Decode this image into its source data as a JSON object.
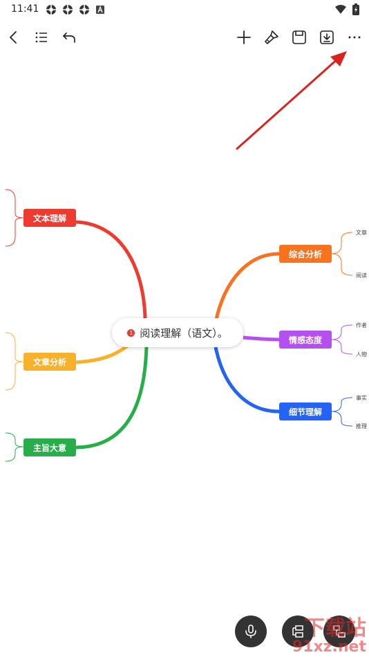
{
  "status_bar": {
    "time": "11:41"
  },
  "mindmap": {
    "root": {
      "label": "阅读理解（语文）。",
      "badge": "1"
    },
    "branches": [
      {
        "label": "文本理解",
        "color": "#ef3b2f"
      },
      {
        "label": "文章分析",
        "color": "#f7b12b"
      },
      {
        "label": "主旨大意",
        "color": "#27ae4a"
      },
      {
        "label": "综合分析",
        "color": "#f7731f",
        "children": [
          "文章",
          "阅读"
        ]
      },
      {
        "label": "情感态度",
        "color": "#b44ff0",
        "children": [
          "作者",
          "人物"
        ]
      },
      {
        "label": "细节理解",
        "color": "#2463f5",
        "children": [
          "事实",
          "推理"
        ]
      }
    ]
  },
  "watermark": {
    "line1": "下载站",
    "line2": "91xz.net"
  },
  "colors": {
    "annotation_arrow": "#d9231f"
  }
}
